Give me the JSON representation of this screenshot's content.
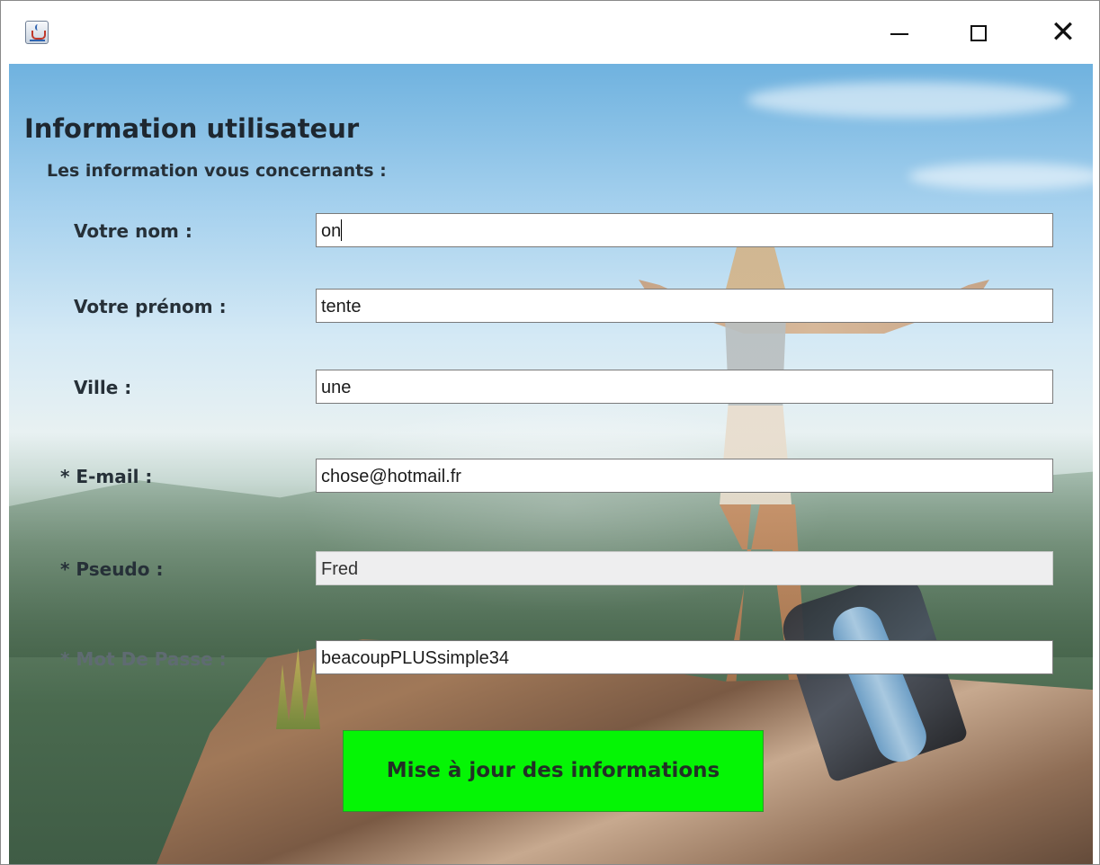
{
  "window": {
    "minimize_symbol": "—",
    "maximize_symbol": "☐",
    "close_symbol": "✕",
    "app_icon": "java-cup-icon"
  },
  "form": {
    "title": "Information utilisateur",
    "subtitle": "Les information vous concernants :",
    "fields": {
      "nom": {
        "label": "Votre nom :",
        "value": "on"
      },
      "prenom": {
        "label": "Votre prénom :",
        "value": "tente"
      },
      "ville": {
        "label": "Ville :",
        "value": "une"
      },
      "email": {
        "label": "* E-mail :",
        "value": "chose@hotmail.fr"
      },
      "pseudo": {
        "label": "* Pseudo :",
        "value": "Fred"
      },
      "password": {
        "label": "* Mot De Passe :",
        "value": "beacoupPLUSsimple34"
      }
    },
    "submit_label": "Mise à jour des informations",
    "colors": {
      "button": "#05f505",
      "disabled_field": "#eeeeef"
    }
  }
}
